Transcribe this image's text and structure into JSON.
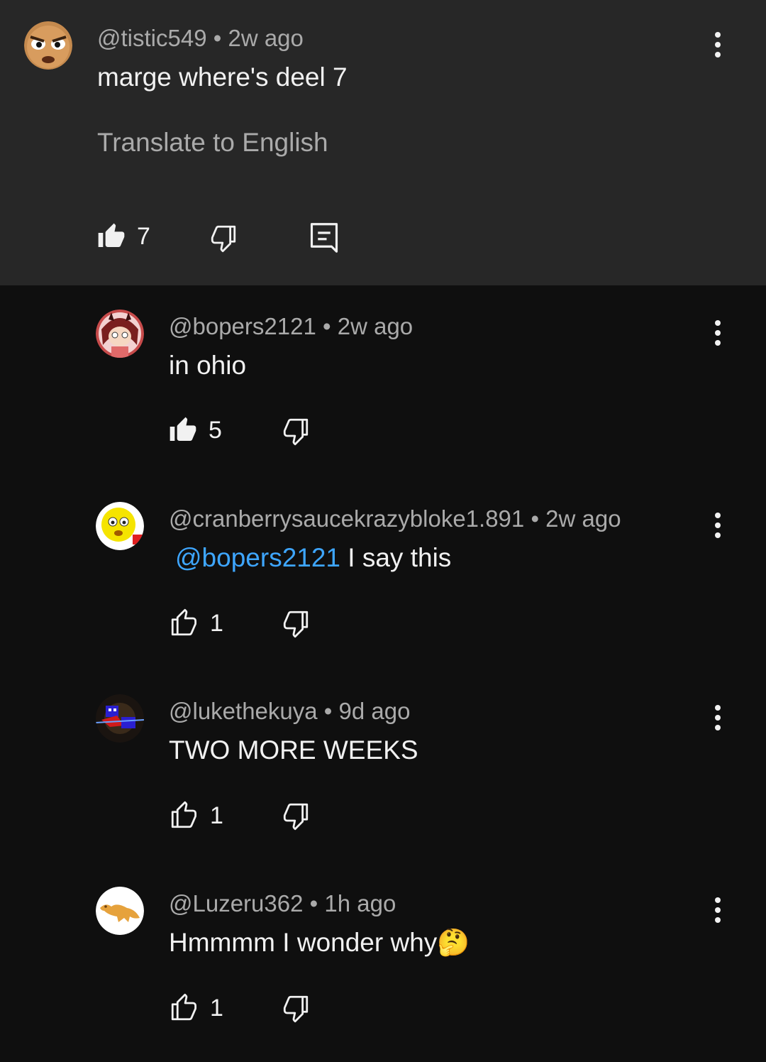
{
  "parent_comment": {
    "handle": "@tistic549",
    "time": "2w ago",
    "text": "marge where's deel 7",
    "translate_label": "Translate to English",
    "likes": "7",
    "liked": true
  },
  "replies": [
    {
      "handle": "@bopers2121",
      "time": "2w ago",
      "mention": "",
      "text": "in ohio",
      "likes": "5",
      "liked": true
    },
    {
      "handle": "@cranberrysaucekrazybloke1.891",
      "time": "2w ago",
      "mention": "@bopers2121",
      "text": "I say this",
      "likes": "1",
      "liked": false
    },
    {
      "handle": "@lukethekuya",
      "time": "9d ago",
      "mention": "",
      "text": "TWO MORE WEEKS",
      "likes": "1",
      "liked": false
    },
    {
      "handle": "@Luzeru362",
      "time": "1h ago",
      "mention": "",
      "text": "Hmmmm I wonder why",
      "emoji": "🤔",
      "likes": "1",
      "liked": false
    }
  ],
  "separator": "•",
  "colors": {
    "background": "#0f0f0f",
    "highlight_background": "#272727",
    "primary_text": "#f1f1f1",
    "secondary_text": "#aaaaaa",
    "mention": "#3ea6ff"
  }
}
